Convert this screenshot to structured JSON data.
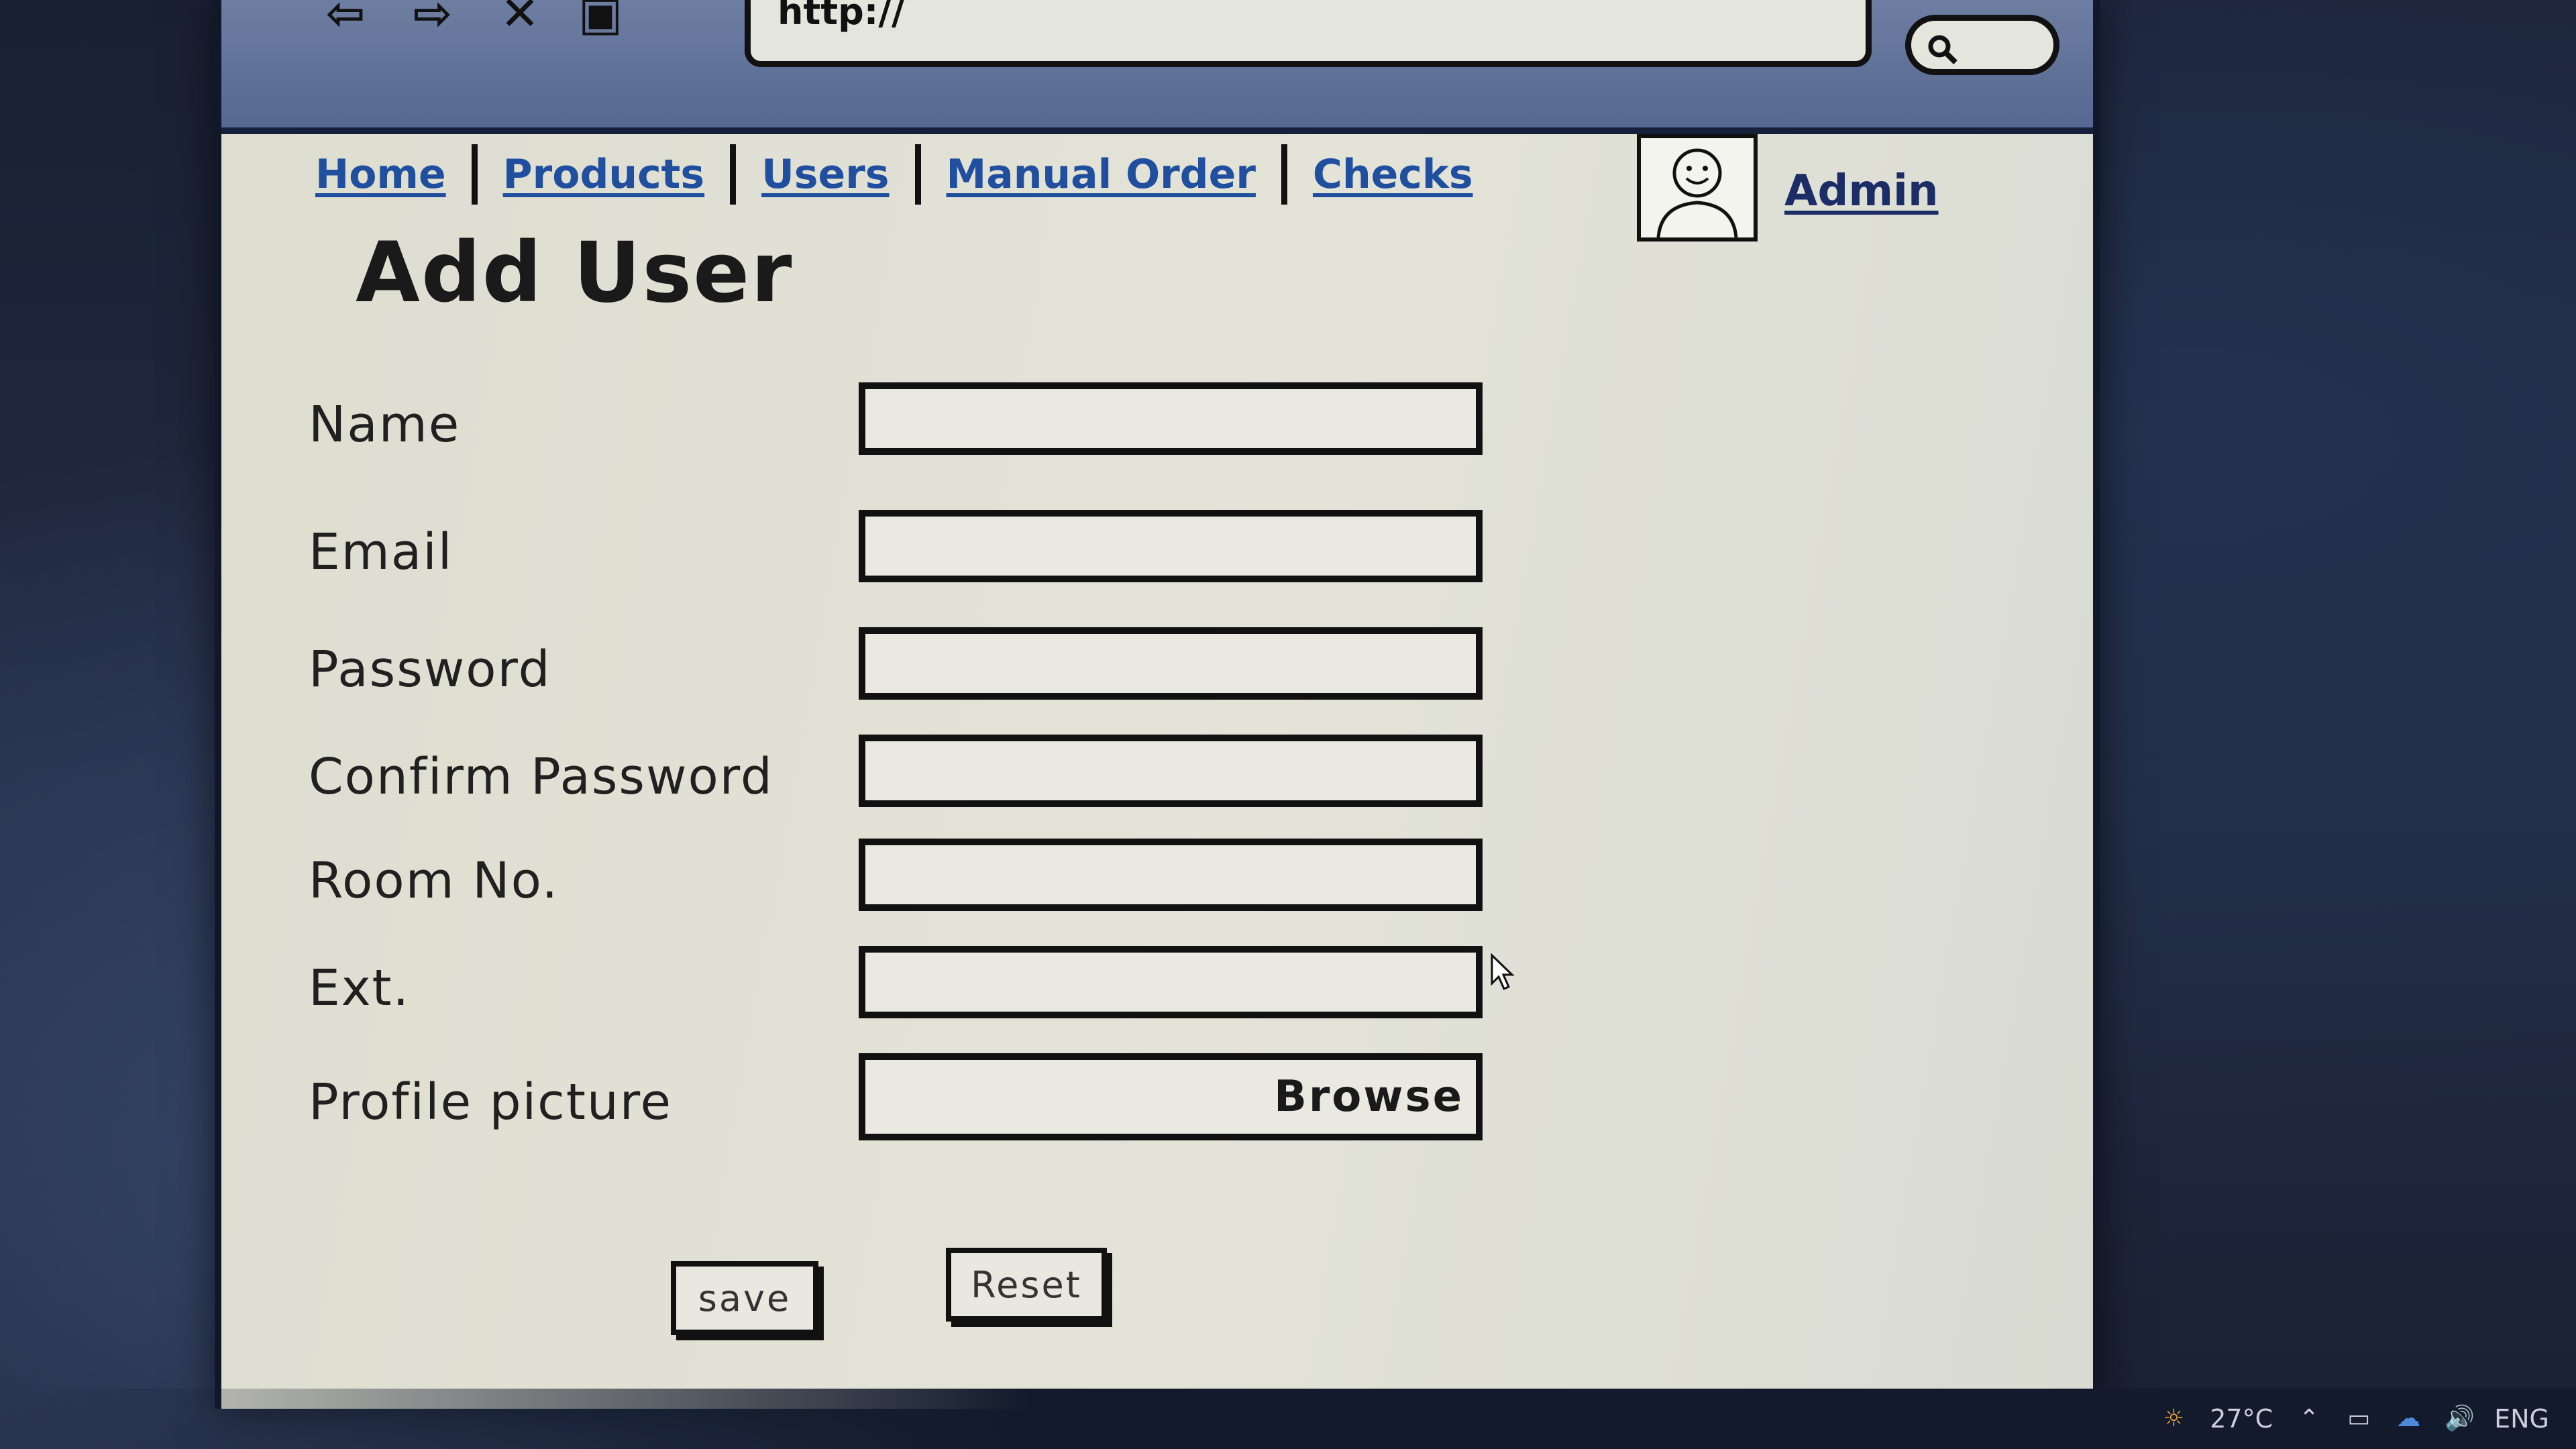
{
  "browser": {
    "url": "http://",
    "back_icon": "back-arrow-icon",
    "forward_icon": "forward-arrow-icon",
    "close_icon": "close-icon",
    "bookmark_icon": "bookmark-icon",
    "search_icon": "search-icon"
  },
  "nav": {
    "links": [
      {
        "label": "Home"
      },
      {
        "label": "Products"
      },
      {
        "label": "Users"
      },
      {
        "label": "Manual Order"
      },
      {
        "label": "Checks"
      }
    ],
    "user_label": "Admin",
    "avatar_icon": "smiley-avatar-icon"
  },
  "page": {
    "title": "Add User"
  },
  "form": {
    "fields": [
      {
        "label": "Name",
        "value": ""
      },
      {
        "label": "Email",
        "value": ""
      },
      {
        "label": "Password",
        "value": ""
      },
      {
        "label": "Confirm Password",
        "value": ""
      },
      {
        "label": "Room No.",
        "value": ""
      },
      {
        "label": "Ext.",
        "value": ""
      }
    ],
    "profile_picture_label": "Profile picture",
    "browse_label": "Browse",
    "save_label": "save",
    "reset_label": "Reset"
  },
  "taskbar": {
    "temperature": "27°C",
    "language": "ENG"
  },
  "colors": {
    "link": "#1f4f9e",
    "browser_chrome": "#6e7ea2",
    "page_background": "#e3e3d8"
  }
}
